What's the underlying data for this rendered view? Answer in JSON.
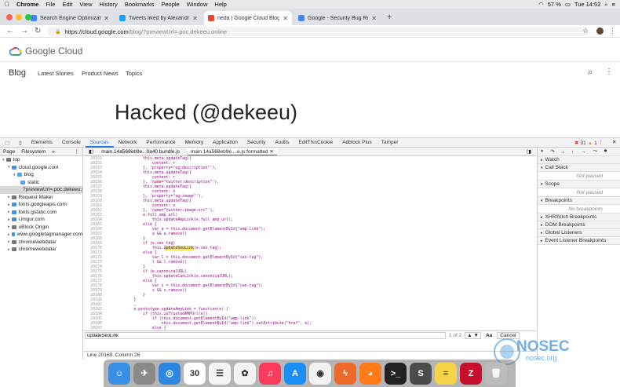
{
  "menubar": {
    "app": "Chrome",
    "items": [
      "File",
      "Edit",
      "View",
      "History",
      "Bookmarks",
      "People",
      "Window",
      "Help"
    ],
    "battery": "57 %",
    "clock": "Tue 14:52"
  },
  "tabs": [
    {
      "title": "Search Engine Optimization (S",
      "color": "#4285f4"
    },
    {
      "title": "Tweets liked by Alexandru Cori",
      "color": "#1da1f2"
    },
    {
      "title": "neda | Google Cloud Blog",
      "color": "#ea4335"
    },
    {
      "title": "Google - Security Bug Report",
      "color": "#4285f4"
    }
  ],
  "address": {
    "host": "https://cloud.google.com",
    "path": "/blog/?previewUrl=.poc.dekeeu.online"
  },
  "page": {
    "logo": "Google Cloud",
    "blog": "Blog",
    "nav": [
      "Latest Stories",
      "Product News",
      "Topics"
    ],
    "headline": "Hacked (@dekeeu)"
  },
  "devtools": {
    "tabs": [
      "Elements",
      "Console",
      "Sources",
      "Network",
      "Performance",
      "Memory",
      "Application",
      "Security",
      "Audits",
      "EditThisCookie",
      "Adblock Plus",
      "Tamper"
    ],
    "errors": "31",
    "warnings": "1",
    "nav_tabs": [
      "Page",
      "Filesystem",
      "»"
    ],
    "tree": [
      {
        "label": "top",
        "indent": 0,
        "icon": "#777",
        "sel": false
      },
      {
        "label": "cloud.google.com",
        "indent": 1,
        "icon": "#4a90d9",
        "sel": false
      },
      {
        "label": "blog",
        "indent": 2,
        "icon": "#5aa0e6",
        "sel": false
      },
      {
        "label": "static",
        "indent": 3,
        "icon": "#5aa0e6",
        "sel": false
      },
      {
        "label": "?previewUrl=.poc.dekeeu.onl",
        "indent": 3,
        "icon": "#aaa",
        "sel": true
      },
      {
        "label": "Request Maker",
        "indent": 1,
        "icon": "#777",
        "sel": false
      },
      {
        "label": "fonts.googleapis.com",
        "indent": 1,
        "icon": "#4a90d9",
        "sel": false
      },
      {
        "label": "fonts.gstatic.com",
        "indent": 1,
        "icon": "#4a90d9",
        "sel": false
      },
      {
        "label": "i.imgur.com",
        "indent": 1,
        "icon": "#4a90d9",
        "sel": false
      },
      {
        "label": "uBlock Origin",
        "indent": 1,
        "icon": "#777",
        "sel": false
      },
      {
        "label": "www.googletagmanager.com",
        "indent": 1,
        "icon": "#4a90d9",
        "sel": false
      },
      {
        "label": "chromewebdata/",
        "indent": 1,
        "icon": "#777",
        "sel": false
      },
      {
        "label": "chromewebdata/",
        "indent": 1,
        "icon": "#777",
        "sel": false
      }
    ],
    "file_tabs": [
      "main.14a568eb9e...0a40.bundle.js",
      "main.14a568eb9e....e.js:formatted"
    ],
    "code": [
      {
        "n": "20151",
        "t": "                this.meta.updateTag({"
      },
      {
        "n": "20152",
        "t": "                    content: r"
      },
      {
        "n": "20153",
        "t": "                }, 'property=\"og:description\"'),"
      },
      {
        "n": "20154",
        "t": "                this.meta.updateTag({"
      },
      {
        "n": "20155",
        "t": "                    content: r"
      },
      {
        "n": "20156",
        "t": "                }, 'name=\"twitter:description\"'),"
      },
      {
        "n": "20157",
        "t": "                this.meta.updateTag({"
      },
      {
        "n": "20158",
        "t": "                    content: o"
      },
      {
        "n": "20159",
        "t": "                }, 'property=\"og:image\"'),"
      },
      {
        "n": "20160",
        "t": "                this.meta.updateTag({"
      },
      {
        "n": "20161",
        "t": "                    content: o"
      },
      {
        "n": "20162",
        "t": "                }, 'name=\"twitter:image:src\"'),"
      },
      {
        "n": "20163",
        "t": "                e.full_amp_url)"
      },
      {
        "n": "20164",
        "t": "                    this.updateAmpLink(e.full_amp_url);"
      },
      {
        "n": "20165",
        "t": "                else {"
      },
      {
        "n": "20166",
        "t": "                    var a = this.document.getElementById(\"amp-link\");"
      },
      {
        "n": "20167",
        "t": "                    a && a.remove()"
      },
      {
        "n": "20168",
        "t": "                }"
      },
      {
        "n": "20169",
        "t": "                if (e.seo_tag)"
      },
      {
        "n": "20170",
        "t": "                    this.",
        "hl": "updateSeoLink",
        "t2": "(e.seo_tag);"
      },
      {
        "n": "20171",
        "t": "                else {"
      },
      {
        "n": "20172",
        "t": "                    var l = this.document.getElementById(\"seo-tag\");"
      },
      {
        "n": "20173",
        "t": "                    l && l.remove()"
      },
      {
        "n": "20174",
        "t": "                }"
      },
      {
        "n": "20175",
        "t": "                if (e.canonicalURL)"
      },
      {
        "n": "20176",
        "t": "                    this.updateCanLink(e.canonicalURL);"
      },
      {
        "n": "20177",
        "t": "                else {"
      },
      {
        "n": "20178",
        "t": "                    var s = this.document.getElementById(\"can-tag\");"
      },
      {
        "n": "20179",
        "t": "                    s && s.remove()"
      },
      {
        "n": "20180",
        "t": "                }"
      },
      {
        "n": "20181",
        "t": "            }"
      },
      {
        "n": "20182",
        "t": "            ,"
      },
      {
        "n": "20183",
        "t": "            e.prototype.updateAmpLink = function(e) {"
      },
      {
        "n": "20184",
        "t": "                if (this.isTrustedAMPUrl(e))"
      },
      {
        "n": "20185",
        "t": "                    if (this.document.getElementById(\"amp-link\"))"
      },
      {
        "n": "20186",
        "t": "                        this.document.getElementById(\"amp-link\").setAttribute(\"href\", e);"
      },
      {
        "n": "20187",
        "t": "                    else {"
      },
      {
        "n": "20188",
        "t": "                        var t = this.document.createElement(\"link\");"
      }
    ],
    "search_value": "updateSeoLink",
    "search_count": "1 of 2",
    "search_aa": "Aa",
    "cancel": "Cancel",
    "status": "Line 20169, Column 26",
    "panels": [
      {
        "label": "Watch",
        "note": ""
      },
      {
        "label": "Call Stack",
        "note": "Not paused"
      },
      {
        "label": "Scope",
        "note": "Not paused"
      },
      {
        "label": "Breakpoints",
        "note": "No breakpoints"
      },
      {
        "label": "XHR/fetch Breakpoints",
        "note": ""
      },
      {
        "label": "DOM Breakpoints",
        "note": ""
      },
      {
        "label": "Global Listeners",
        "note": ""
      },
      {
        "label": "Event Listener Breakpoints",
        "note": ""
      }
    ]
  },
  "watermark": {
    "title": "NOSEC",
    "sub": "nosec.org"
  },
  "dock": [
    {
      "name": "finder-icon",
      "color": "#3a8ee6",
      "g": "☺"
    },
    {
      "name": "launchpad-icon",
      "color": "#8a8a8a",
      "g": "✈"
    },
    {
      "name": "safari-icon",
      "color": "#2d87e0",
      "g": "◎"
    },
    {
      "name": "calendar-icon",
      "color": "#ffffff",
      "g": "30",
      "dark": true
    },
    {
      "name": "notes-icon",
      "color": "#f5f5f5",
      "g": "☰",
      "dark": true
    },
    {
      "name": "photos-icon",
      "color": "#f3f3f3",
      "g": "✿",
      "dark": true
    },
    {
      "name": "music-icon",
      "color": "#fa3b5c",
      "g": "♫"
    },
    {
      "name": "app-store-icon",
      "color": "#1c8ff5",
      "g": "A"
    },
    {
      "name": "chrome-icon",
      "color": "#f2f2f2",
      "g": "◉",
      "dark": true
    },
    {
      "name": "burp-icon",
      "color": "#ee6a2b",
      "g": "ϟ"
    },
    {
      "name": "firefox-icon",
      "color": "#ff7a18",
      "g": "◕"
    },
    {
      "name": "terminal-icon",
      "color": "#222222",
      "g": ">_"
    },
    {
      "name": "sublime-icon",
      "color": "#4b4b4b",
      "g": "S"
    },
    {
      "name": "stickies-icon",
      "color": "#f7d34a",
      "g": "≡",
      "dark": true
    },
    {
      "name": "filezilla-icon",
      "color": "#c8102e",
      "g": "Z"
    },
    {
      "name": "trash-icon",
      "color": "#bcbcbc",
      "g": "🗑"
    }
  ]
}
